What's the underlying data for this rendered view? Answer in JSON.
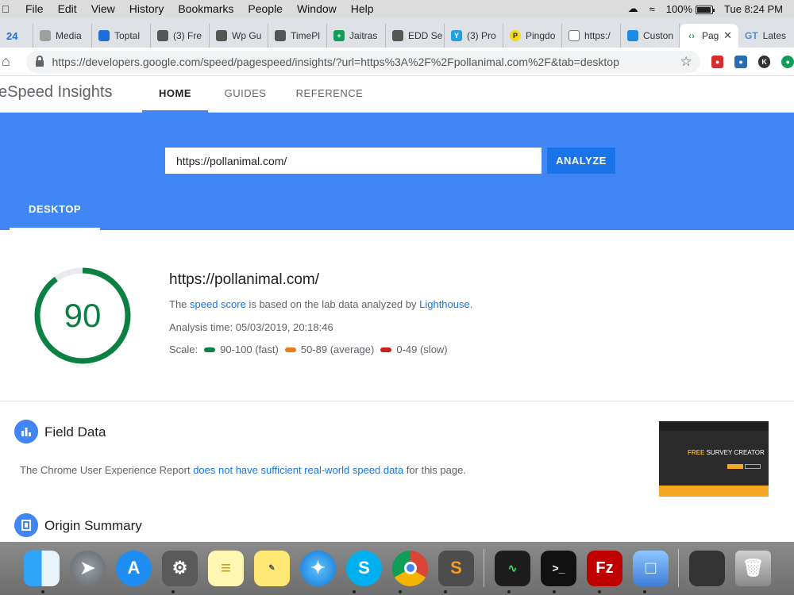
{
  "menubar": {
    "items": [
      "File",
      "Edit",
      "View",
      "History",
      "Bookmarks",
      "People",
      "Window",
      "Help"
    ],
    "battery": "100%",
    "clock": "Tue 8:24 PM"
  },
  "tabs": [
    {
      "label": "24",
      "color": "#1a73e8"
    },
    {
      "label": "Media",
      "color": "#9e9e9e"
    },
    {
      "label": "Toptal",
      "color": "#1e6fd9"
    },
    {
      "label": "(3) Fre",
      "color": "#555555"
    },
    {
      "label": "Wp Gu",
      "color": "#555555"
    },
    {
      "label": "TimePl",
      "color": "#555555"
    },
    {
      "label": "Jaitras",
      "color": "#0f9d58"
    },
    {
      "label": "EDD Se",
      "color": "#555555"
    },
    {
      "label": "(3) Pro",
      "color": "#1ea2e0"
    },
    {
      "label": "Pingdo",
      "color": "#f4d81a"
    },
    {
      "label": "https:/",
      "color": "#777777"
    },
    {
      "label": "Custon",
      "color": "#1e88e5"
    },
    {
      "label": "Pag",
      "color": "#34a853",
      "active": true
    },
    {
      "label": "Lates",
      "color": "#4a90d9"
    }
  ],
  "address": {
    "url": "https://developers.google.com/speed/pagespeed/insights/?url=https%3A%2F%2Fpollanimal.com%2F&tab=desktop"
  },
  "psi": {
    "brand": "eSpeed Insights",
    "nav": [
      "HOME",
      "GUIDES",
      "REFERENCE"
    ],
    "input_value": "https://pollanimal.com/",
    "analyze_label": "ANALYZE",
    "desktop_tab": "DESKTOP"
  },
  "score": {
    "value": 90,
    "url": "https://pollanimal.com/",
    "line1_pre": "The ",
    "line1_link1": "speed score",
    "line1_mid": " is based on the lab data analyzed by ",
    "line1_link2": "Lighthouse",
    "line1_post": ".",
    "analysis_time": "Analysis time: 05/03/2019, 20:18:46",
    "scale_label": "Scale:",
    "scale_fast": "90-100 (fast)",
    "scale_avg": "50-89 (average)",
    "scale_slow": "0-49 (slow)",
    "colors": {
      "fast": "#0b8043",
      "avg": "#e67c18",
      "slow": "#c5221f"
    }
  },
  "field": {
    "title": "Field Data",
    "text_pre": "The Chrome User Experience Report ",
    "text_link": "does not have sufficient real-world speed data",
    "text_post": " for this page.",
    "thumb_accent": "FREE",
    "thumb_text": "SURVEY CREATOR"
  },
  "origin": {
    "title": "Origin Summary"
  }
}
